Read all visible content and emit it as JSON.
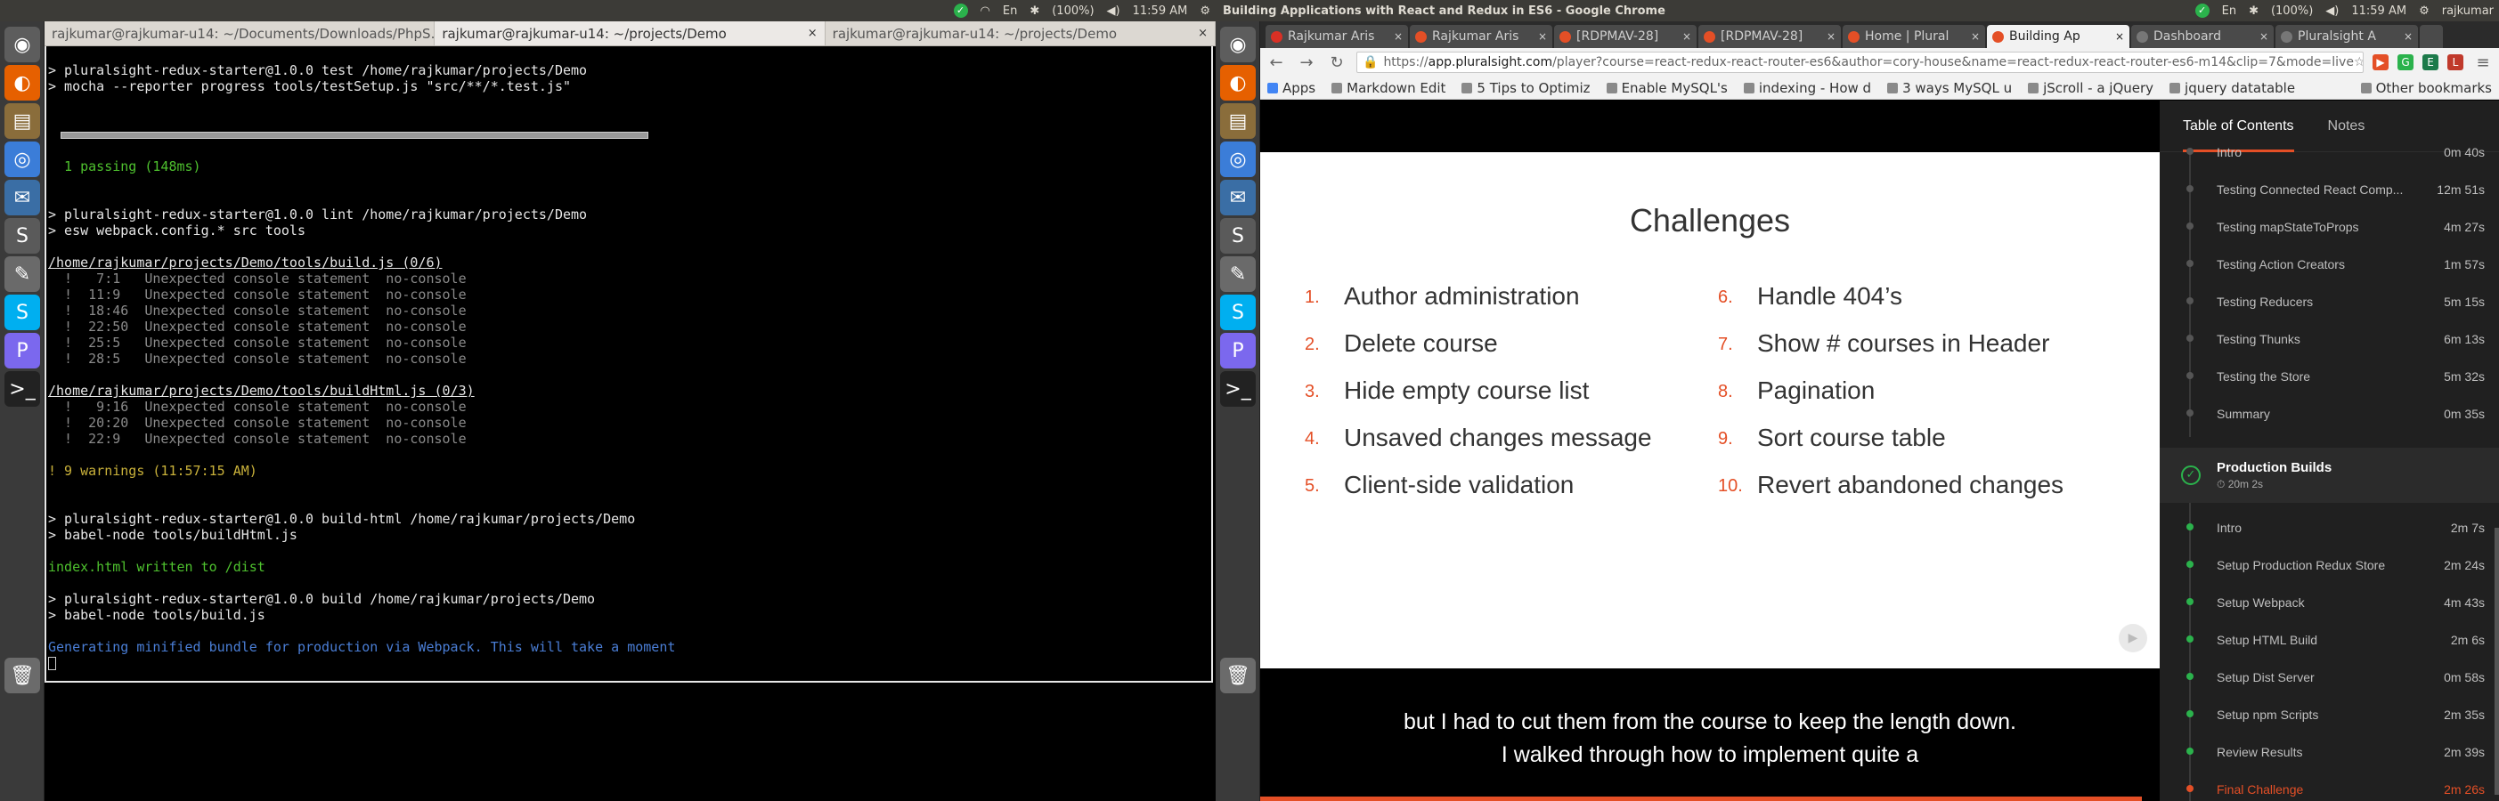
{
  "left": {
    "topbar_title": "",
    "tray": {
      "battery": "(100%)",
      "time": "11:59 AM"
    },
    "launcher": [
      {
        "name": "dash-icon",
        "glyph": "◉"
      },
      {
        "name": "firefox-icon",
        "glyph": "◐"
      },
      {
        "name": "files-icon",
        "glyph": "▤"
      },
      {
        "name": "chrome-icon",
        "glyph": "◎"
      },
      {
        "name": "thunderbird-icon",
        "glyph": "✉"
      },
      {
        "name": "sublime-icon",
        "glyph": "S"
      },
      {
        "name": "text-editor-icon",
        "glyph": "✎"
      },
      {
        "name": "skype-icon",
        "glyph": "S"
      },
      {
        "name": "phpstorm-icon",
        "glyph": "P"
      },
      {
        "name": "terminal-icon",
        "glyph": ">_"
      },
      {
        "name": "trash-icon",
        "glyph": "🗑"
      }
    ],
    "terminal_tabs": [
      {
        "label": "rajkumar@rajkumar-u14: ~/Documents/Downloads/PhpS…",
        "close": "×"
      },
      {
        "label": "rajkumar@rajkumar-u14: ~/projects/Demo",
        "close": "×"
      },
      {
        "label": "rajkumar@rajkumar-u14: ~/projects/Demo",
        "close": "×"
      }
    ],
    "terminal_lines": [
      {
        "t": "",
        "c": ""
      },
      {
        "t": "> pluralsight-redux-starter@1.0.0 test /home/rajkumar/projects/Demo",
        "c": "c-white"
      },
      {
        "t": "> mocha --reporter progress tools/testSetup.js \"src/**/*.test.js\"",
        "c": "c-white"
      },
      {
        "t": "",
        "c": ""
      },
      {
        "t": "",
        "c": ""
      },
      {
        "t": "__PROGRESS__",
        "c": "c-gray"
      },
      {
        "t": "",
        "c": ""
      },
      {
        "t": "  1 passing (148ms)",
        "c": "c-green"
      },
      {
        "t": "",
        "c": ""
      },
      {
        "t": "",
        "c": ""
      },
      {
        "t": "> pluralsight-redux-starter@1.0.0 lint /home/rajkumar/projects/Demo",
        "c": "c-white"
      },
      {
        "t": "> esw webpack.config.* src tools",
        "c": "c-white"
      },
      {
        "t": "",
        "c": ""
      },
      {
        "t": "/home/rajkumar/projects/Demo/tools/build.js (0/6)",
        "c": "c-path"
      },
      {
        "t": "  !   7:1   Unexpected console statement  no-console",
        "c": "c-gray"
      },
      {
        "t": "  !  11:9   Unexpected console statement  no-console",
        "c": "c-gray"
      },
      {
        "t": "  !  18:46  Unexpected console statement  no-console",
        "c": "c-gray"
      },
      {
        "t": "  !  22:50  Unexpected console statement  no-console",
        "c": "c-gray"
      },
      {
        "t": "  !  25:5   Unexpected console statement  no-console",
        "c": "c-gray"
      },
      {
        "t": "  !  28:5   Unexpected console statement  no-console",
        "c": "c-gray"
      },
      {
        "t": "",
        "c": ""
      },
      {
        "t": "/home/rajkumar/projects/Demo/tools/buildHtml.js (0/3)",
        "c": "c-path"
      },
      {
        "t": "  !   9:16  Unexpected console statement  no-console",
        "c": "c-gray"
      },
      {
        "t": "  !  20:20  Unexpected console statement  no-console",
        "c": "c-gray"
      },
      {
        "t": "  !  22:9   Unexpected console statement  no-console",
        "c": "c-gray"
      },
      {
        "t": "",
        "c": ""
      },
      {
        "t": "! 9 warnings (11:57:15 AM)",
        "c": "c-yellow"
      },
      {
        "t": "",
        "c": ""
      },
      {
        "t": "",
        "c": ""
      },
      {
        "t": "> pluralsight-redux-starter@1.0.0 build-html /home/rajkumar/projects/Demo",
        "c": "c-white"
      },
      {
        "t": "> babel-node tools/buildHtml.js",
        "c": "c-white"
      },
      {
        "t": "",
        "c": ""
      },
      {
        "t": "index.html written to /dist",
        "c": "c-green"
      },
      {
        "t": "",
        "c": ""
      },
      {
        "t": "> pluralsight-redux-starter@1.0.0 build /home/rajkumar/projects/Demo",
        "c": "c-white"
      },
      {
        "t": "> babel-node tools/build.js",
        "c": "c-white"
      },
      {
        "t": "",
        "c": ""
      },
      {
        "t": "Generating minified bundle for production via Webpack. This will take a moment",
        "c": "c-blue"
      },
      {
        "t": "__CURSOR__",
        "c": ""
      }
    ]
  },
  "right": {
    "topbar_title": "Building Applications with React and Redux in ES6 - Google Chrome",
    "tray": {
      "battery": "(100%)",
      "time": "11:59 AM",
      "user": "rajkumar"
    },
    "chrome_tabs": [
      {
        "label": "Rajkumar Aris",
        "color": "#d93025",
        "active": false
      },
      {
        "label": "Rajkumar Aris",
        "color": "#e44f26",
        "active": false
      },
      {
        "label": "[RDPMAV-28]",
        "color": "#e44f26",
        "active": false
      },
      {
        "label": "[RDPMAV-28]",
        "color": "#e44f26",
        "active": false
      },
      {
        "label": "Home | Plural",
        "color": "#e44f26",
        "active": false
      },
      {
        "label": "Building Ap",
        "color": "#e44f26",
        "active": true
      },
      {
        "label": "Dashboard",
        "color": "#777777",
        "active": false
      },
      {
        "label": "Pluralsight A",
        "color": "#777777",
        "active": false
      }
    ],
    "omnibox": {
      "scheme": "https://",
      "host": "app.pluralsight.com",
      "path": "/player?course=react-redux-react-router-es6&author=cory-house&name=react-redux-react-router-es6-m14&clip=7&mode=live"
    },
    "bookmarks": [
      "Apps",
      "Markdown Edit",
      "5 Tips to Optimiz",
      "Enable MySQL's",
      "indexing - How d",
      "3 ways MySQL u",
      "jScroll - a jQuery",
      "jquery datatable"
    ],
    "bookmarks_other": "Other bookmarks",
    "slide": {
      "title": "Challenges",
      "items": [
        {
          "num": "1.",
          "text": "Author administration"
        },
        {
          "num": "2.",
          "text": "Delete course"
        },
        {
          "num": "3.",
          "text": "Hide empty course list"
        },
        {
          "num": "4.",
          "text": "Unsaved changes message"
        },
        {
          "num": "5.",
          "text": "Client-side validation"
        },
        {
          "num": "6.",
          "text": "Handle 404’s"
        },
        {
          "num": "7.",
          "text": "Show # courses in Header"
        },
        {
          "num": "8.",
          "text": "Pagination"
        },
        {
          "num": "9.",
          "text": "Sort course table"
        },
        {
          "num": "10.",
          "text": "Revert abandoned changes"
        }
      ]
    },
    "caption_lines": [
      "but I had to cut them from the course to keep the length down.",
      "I walked through how to implement quite a"
    ],
    "video_progress": 0.98,
    "toc": {
      "tabs": [
        "Table of Contents",
        "Notes"
      ],
      "partial_top": {
        "label": "Intro",
        "dur": "0m 40s"
      },
      "clips_a": [
        {
          "label": "Testing Connected React Comp...",
          "dur": "12m 51s"
        },
        {
          "label": "Testing mapStateToProps",
          "dur": "4m 27s"
        },
        {
          "label": "Testing Action Creators",
          "dur": "1m 57s"
        },
        {
          "label": "Testing Reducers",
          "dur": "5m 15s"
        },
        {
          "label": "Testing Thunks",
          "dur": "6m 13s"
        },
        {
          "label": "Testing the Store",
          "dur": "5m 32s"
        },
        {
          "label": "Summary",
          "dur": "0m 35s"
        }
      ],
      "module": {
        "title": "Production Builds",
        "dur": "⏱ 20m 2s"
      },
      "clips_b": [
        {
          "label": "Intro",
          "dur": "2m 7s",
          "state": "done"
        },
        {
          "label": "Setup Production Redux Store",
          "dur": "2m 24s",
          "state": "done"
        },
        {
          "label": "Setup Webpack",
          "dur": "4m 43s",
          "state": "done"
        },
        {
          "label": "Setup HTML Build",
          "dur": "2m 6s",
          "state": "done"
        },
        {
          "label": "Setup Dist Server",
          "dur": "0m 58s",
          "state": "done"
        },
        {
          "label": "Setup npm Scripts",
          "dur": "2m 35s",
          "state": "done"
        },
        {
          "label": "Review Results",
          "dur": "2m 39s",
          "state": "done"
        },
        {
          "label": "Final Challenge",
          "dur": "2m 26s",
          "state": "current"
        }
      ]
    }
  },
  "colors": {
    "accent": "#e44f26",
    "done": "#2bb24c",
    "topbar": "#3c3b37"
  }
}
